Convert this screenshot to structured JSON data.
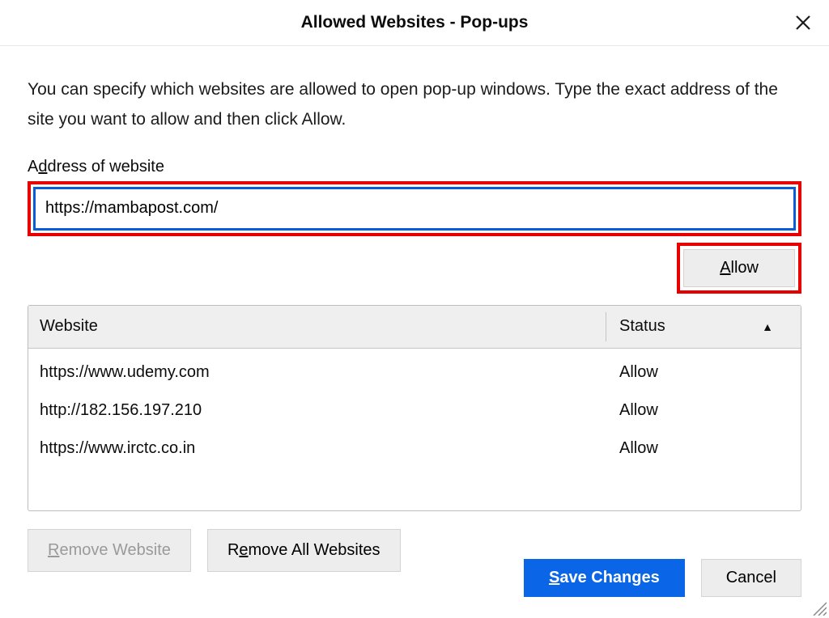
{
  "title": "Allowed Websites - Pop-ups",
  "intro": "You can specify which websites are allowed to open pop-up windows. Type the exact address of the site you want to allow and then click Allow.",
  "address_label_pre": "A",
  "address_label_ul": "d",
  "address_label_post": "dress of website",
  "address_value": "https://mambapost.com/",
  "allow_pre": "",
  "allow_ul": "A",
  "allow_post": "llow",
  "table": {
    "col_website": "Website",
    "col_status": "Status",
    "rows": [
      {
        "website": "https://www.udemy.com",
        "status": "Allow"
      },
      {
        "website": "http://182.156.197.210",
        "status": "Allow"
      },
      {
        "website": "https://www.irctc.co.in",
        "status": "Allow"
      }
    ]
  },
  "remove_website_pre": "",
  "remove_website_ul": "R",
  "remove_website_post": "emove Website",
  "remove_all_pre": "R",
  "remove_all_ul": "e",
  "remove_all_post": "move All Websites",
  "save_pre": "",
  "save_ul": "S",
  "save_post": "ave Changes",
  "cancel": "Cancel"
}
